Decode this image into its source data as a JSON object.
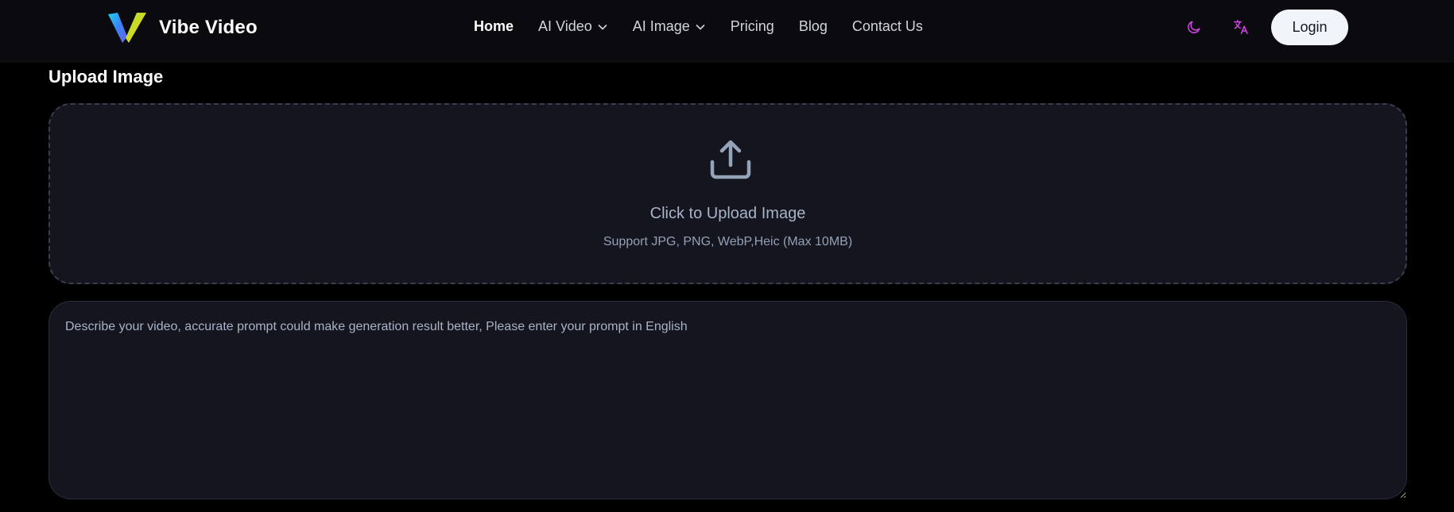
{
  "brand": {
    "name": "Vibe Video",
    "logo_icon": "vibe-logo-icon"
  },
  "nav": {
    "items": [
      {
        "label": "Home",
        "active": true
      },
      {
        "label": "AI Video",
        "dropdown": true
      },
      {
        "label": "AI Image",
        "dropdown": true
      },
      {
        "label": "Pricing"
      },
      {
        "label": "Blog"
      },
      {
        "label": "Contact Us"
      }
    ]
  },
  "header": {
    "theme_icon": "moon-icon",
    "language_icon": "translate-icon",
    "login_label": "Login"
  },
  "upload": {
    "section_title": "Upload Image",
    "icon": "upload-icon",
    "title": "Click to Upload Image",
    "hint": "Support JPG, PNG, WebP,Heic (Max 10MB)"
  },
  "prompt": {
    "placeholder": "Describe your video, accurate prompt could make generation result better, Please enter your prompt in English",
    "value": ""
  },
  "colors": {
    "background": "#000000",
    "navbar": "#0b0b0f",
    "panel": "#15151f",
    "accent_pink": "#d946ef",
    "muted_text": "#a8b3c7",
    "login_bg": "#f1f5f9"
  }
}
